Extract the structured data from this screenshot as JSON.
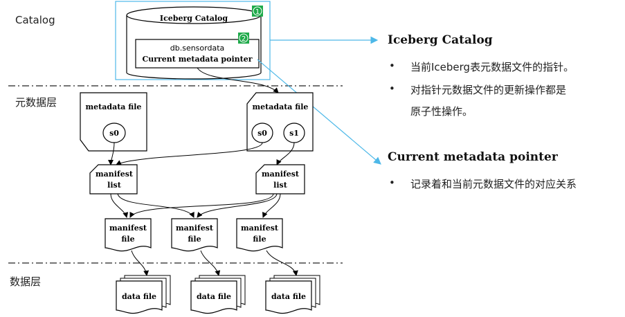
{
  "layers": {
    "catalog": "Catalog",
    "metadata": "元数据层",
    "data": "数据层"
  },
  "catalog_box": {
    "title": "Iceberg Catalog",
    "badge1": "1",
    "badge2": "2",
    "pointer_table": "db.sensordata",
    "pointer_label": "Current metadata pointer"
  },
  "metadata_files": [
    {
      "label": "metadata file",
      "snapshots": [
        "s0"
      ]
    },
    {
      "label": "metadata file",
      "snapshots": [
        "s0",
        "s1"
      ]
    }
  ],
  "manifest_lists": [
    {
      "line1": "manifest",
      "line2": "list"
    },
    {
      "line1": "manifest",
      "line2": "list"
    }
  ],
  "manifest_files": [
    {
      "line1": "manifest",
      "line2": "file"
    },
    {
      "line1": "manifest",
      "line2": "file"
    },
    {
      "line1": "manifest",
      "line2": "file"
    }
  ],
  "data_files": [
    "data file",
    "data file",
    "data file"
  ],
  "right_panel": {
    "catalog_title": "Iceberg Catalog",
    "catalog_bullet1": "当前Iceberg表元数据文件的指针。",
    "catalog_bullet2_line1": "对指针元数据文件的更新操作都是",
    "catalog_bullet2_line2": "原子性操作。",
    "pointer_title": "Current metadata pointer",
    "pointer_bullet1": "记录着和当前元数据文件的对应关系",
    "bullet_char": "•"
  },
  "colors": {
    "callout": "#4db8e8",
    "badge": "#1faa4a",
    "line": "#000000"
  }
}
